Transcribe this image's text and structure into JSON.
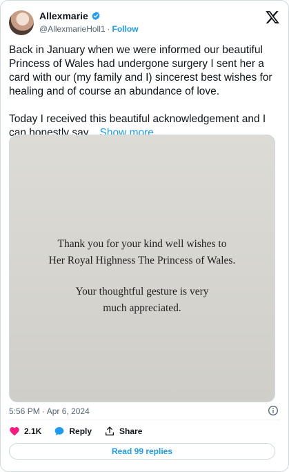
{
  "author": {
    "display_name": "Allexmarie",
    "handle": "@AllexmarieHoll1",
    "separator": "·",
    "follow_label": "Follow"
  },
  "tweet": {
    "text": "Back in January when we were informed our beautiful Princess of Wales had undergone surgery I sent her a card with our (my family and I) sincerest best wishes for healing and of course an abundance of love.\n\nToday I received this beautiful acknowledgement and I can honestly say... ",
    "show_more_label": "Show more",
    "timestamp": "5:56 PM · Apr 6, 2024"
  },
  "media": {
    "card_lines": [
      "Thank you for your kind well wishes to",
      "Her Royal Highness The Princess of Wales.",
      "Your thoughtful gesture is very",
      "much appreciated."
    ]
  },
  "actions": {
    "likes": "2.1K",
    "reply_label": "Reply",
    "share_label": "Share"
  },
  "footer": {
    "read_replies_label": "Read 99 replies"
  },
  "colors": {
    "accent": "#1d9bf0",
    "like": "#f91880",
    "text_secondary": "#536471"
  },
  "icons": [
    "verified-badge-icon",
    "x-logo-icon",
    "info-icon",
    "heart-icon",
    "reply-bubble-icon",
    "share-icon"
  ]
}
